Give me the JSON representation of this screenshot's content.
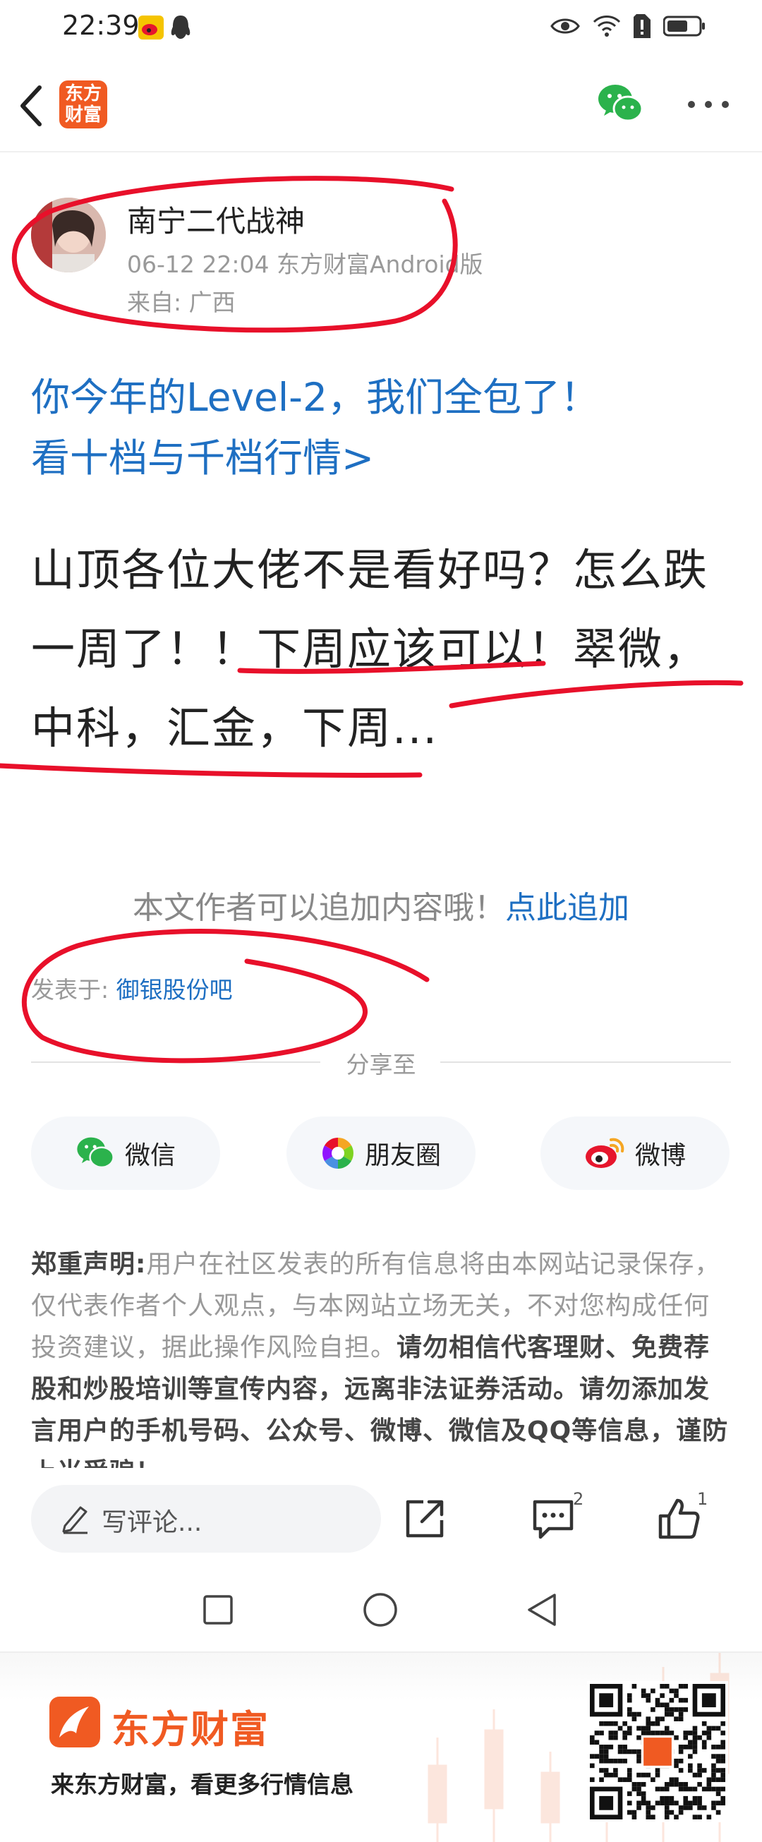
{
  "status_bar": {
    "time": "22:39"
  },
  "app_bar": {
    "logo_text": "东方财富"
  },
  "author": {
    "name": "南宁二代战神",
    "meta": "06-12 22:04 东方财富Android版",
    "location": "来自: 广西"
  },
  "promo": {
    "line1": "你今年的Level-2，我们全包了！",
    "line2": "看十档与千档行情>"
  },
  "post": {
    "body": "山顶各位大佬不是看好吗？怎么跌一周了！！下周应该可以！翠微，中科，汇金，下周..."
  },
  "append": {
    "text": "本文作者可以追加内容哦！",
    "link": "点此追加"
  },
  "posted_in": {
    "label": "发表于:",
    "bar": "御银股份吧"
  },
  "share": {
    "label": "分享至",
    "buttons": [
      {
        "label": "微信",
        "icon": "wechat-icon"
      },
      {
        "label": "朋友圈",
        "icon": "moments-icon"
      },
      {
        "label": "微博",
        "icon": "weibo-icon"
      }
    ]
  },
  "disclaimer": {
    "title": "郑重声明:",
    "text1": "用户在社区发表的所有信息将由本网站记录保存，仅代表作者个人观点，与本网站立场无关，不对您构成任何投资建议，据此操作风险自担。",
    "text2": "请勿相信代客理财、免费荐股和炒股培训等宣传内容，远离非法证券活动。请勿添加发言用户的手机号码、公众号、微博、微信及QQ等信息，谨防上当受骗！"
  },
  "action_bar": {
    "comment_placeholder": "写评论...",
    "comment_count": "2",
    "like_count": "1"
  },
  "banner": {
    "brand": "东方财富",
    "slogan": "来东方财富，看更多行情信息"
  },
  "colors": {
    "brand_orange": "#f05a22",
    "link_blue": "#1e6fc2",
    "annotation_red": "#e8102a"
  }
}
